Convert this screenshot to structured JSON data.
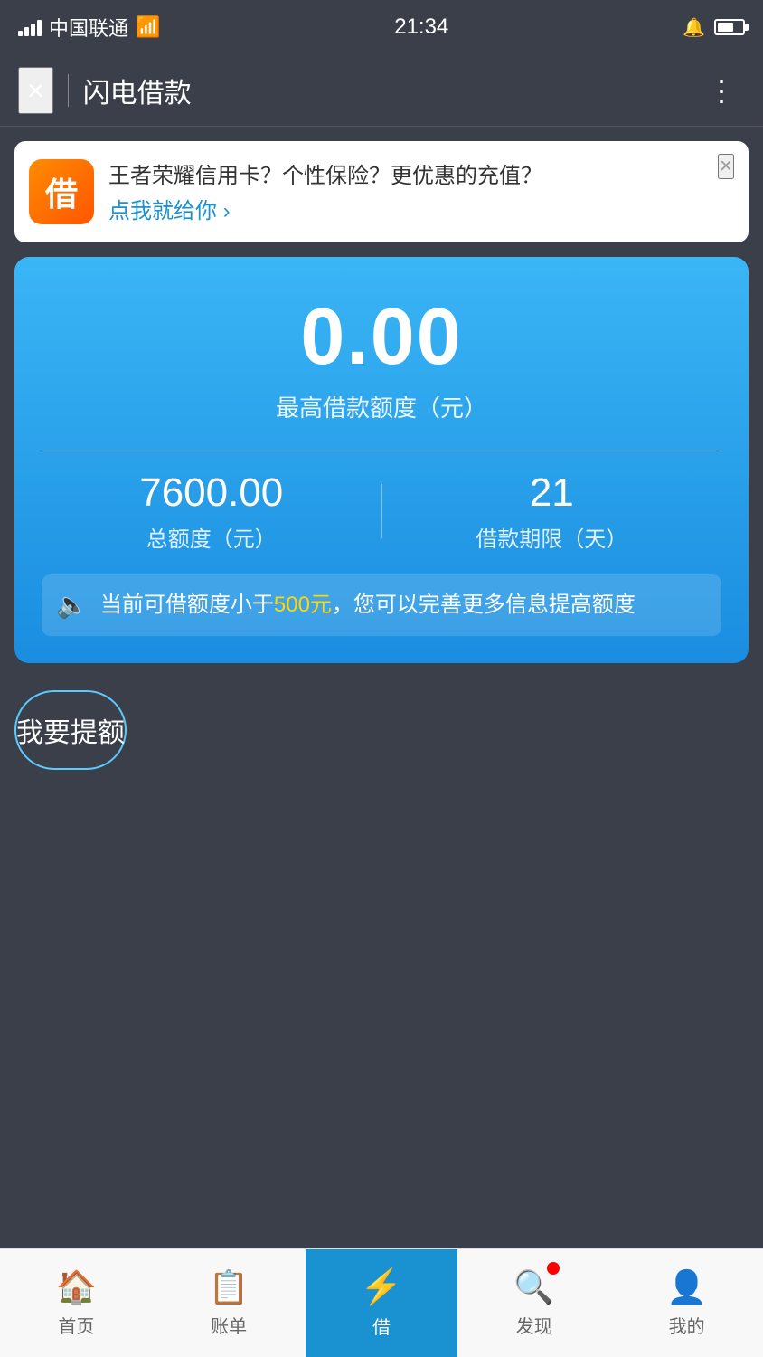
{
  "statusBar": {
    "carrier": "中国联通",
    "time": "21:34",
    "signal": "4G"
  },
  "navBar": {
    "title": "闪电借款",
    "closeLabel": "×",
    "moreLabel": "⋮"
  },
  "adBanner": {
    "mainText": "王者荣耀信用卡？个性保险？更优惠的充值？",
    "linkText": "点我就给你 ›",
    "closeLabel": "×"
  },
  "mainCard": {
    "amountValue": "0.00",
    "amountLabel": "最高借款额度（元）",
    "totalAmount": "7600.00",
    "totalAmountLabel": "总额度（元）",
    "loanDays": "21",
    "loanDaysLabel": "借款期限（天）",
    "noticeText": "当前可借额度小于",
    "noticeHighlight": "500元",
    "noticeSuffix": "，您可以完善更多信息提高额度"
  },
  "increaseLimitButton": {
    "label": "我要提额"
  },
  "bottomNav": {
    "items": [
      {
        "id": "home",
        "label": "首页",
        "icon": "🏠",
        "active": false
      },
      {
        "id": "bill",
        "label": "账单",
        "icon": "📋",
        "active": false
      },
      {
        "id": "borrow",
        "label": "借",
        "icon": "⚡",
        "active": true
      },
      {
        "id": "discover",
        "label": "发现",
        "icon": "🔍",
        "active": false,
        "badge": true
      },
      {
        "id": "mine",
        "label": "我的",
        "icon": "👤",
        "active": false
      }
    ]
  }
}
